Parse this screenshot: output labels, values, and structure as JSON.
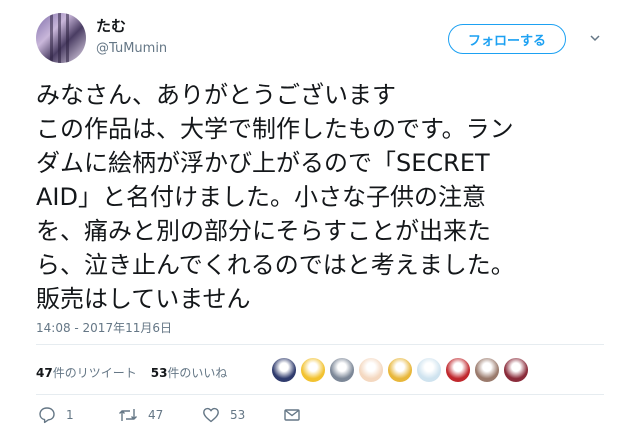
{
  "user": {
    "name": "たむ",
    "handle": "@TuMumin"
  },
  "follow_button": {
    "label": "フォローする"
  },
  "tweet": {
    "text": "みなさん、ありがとうございます\nこの作品は、大学で制作したものです。ラン\nダムに絵柄が浮かび上がるので「SECRET\nAID」と名付けました。小さな子供の注意\nを、痛みと別の部分にそらすことが出来た\nら、泣き止んでくれるのではと考えました。\n販売はしていません",
    "timestamp": "14:08 - 2017年11月6日"
  },
  "stats": {
    "retweets_count": "47",
    "retweets_label": "件のリツイート",
    "likes_count": "53",
    "likes_label": "件のいいね"
  },
  "liker_avatars": [
    {
      "icon": "avatar-1",
      "color": "#2f3b6d"
    },
    {
      "icon": "avatar-2",
      "color": "#f2c230"
    },
    {
      "icon": "avatar-3",
      "color": "#7c8797"
    },
    {
      "icon": "avatar-4",
      "color": "#f4d8c0"
    },
    {
      "icon": "avatar-5",
      "color": "#e8b73a"
    },
    {
      "icon": "avatar-6",
      "color": "#cfe3ef"
    },
    {
      "icon": "avatar-7",
      "color": "#c0282d"
    },
    {
      "icon": "avatar-8",
      "color": "#9a7a6c"
    },
    {
      "icon": "avatar-9",
      "color": "#8a2b3a"
    }
  ],
  "actions": {
    "reply_count": "1",
    "retweet_count": "47",
    "like_count": "53"
  },
  "colors": {
    "accent": "#1da1f2",
    "muted": "#657786",
    "divider": "#e6ecf0"
  }
}
